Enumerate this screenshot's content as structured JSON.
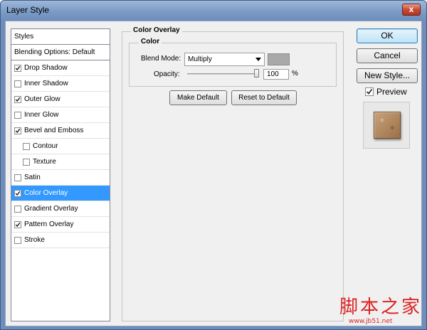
{
  "window": {
    "title": "Layer Style",
    "close_label": "x"
  },
  "styles_list": {
    "header": "Styles",
    "blending": "Blending Options: Default",
    "items": [
      {
        "label": "Drop Shadow",
        "checked": true
      },
      {
        "label": "Inner Shadow",
        "checked": false
      },
      {
        "label": "Outer Glow",
        "checked": true
      },
      {
        "label": "Inner Glow",
        "checked": false
      },
      {
        "label": "Bevel and Emboss",
        "checked": true
      },
      {
        "label": "Contour",
        "checked": false
      },
      {
        "label": "Texture",
        "checked": false
      },
      {
        "label": "Satin",
        "checked": false
      },
      {
        "label": "Color Overlay",
        "checked": true,
        "selected": true
      },
      {
        "label": "Gradient Overlay",
        "checked": false
      },
      {
        "label": "Pattern Overlay",
        "checked": true
      },
      {
        "label": "Stroke",
        "checked": false
      }
    ]
  },
  "panel": {
    "section_title": "Color Overlay",
    "group_title": "Color",
    "blend_mode_label": "Blend Mode:",
    "blend_mode_value": "Multiply",
    "overlay_color": "#a9a9a9",
    "opacity_label": "Opacity:",
    "opacity_value": "100",
    "opacity_unit": "%",
    "opacity_level": 1.0,
    "make_default": "Make Default",
    "reset_default": "Reset to Default"
  },
  "actions": {
    "ok": "OK",
    "cancel": "Cancel",
    "new_style": "New Style...",
    "preview_label": "Preview",
    "preview_checked": true
  },
  "watermark": {
    "text": "脚本之家",
    "url": "www.jb51.net"
  },
  "colors": {
    "selection": "#3399ff",
    "titlebar": "#7c9bc6"
  }
}
